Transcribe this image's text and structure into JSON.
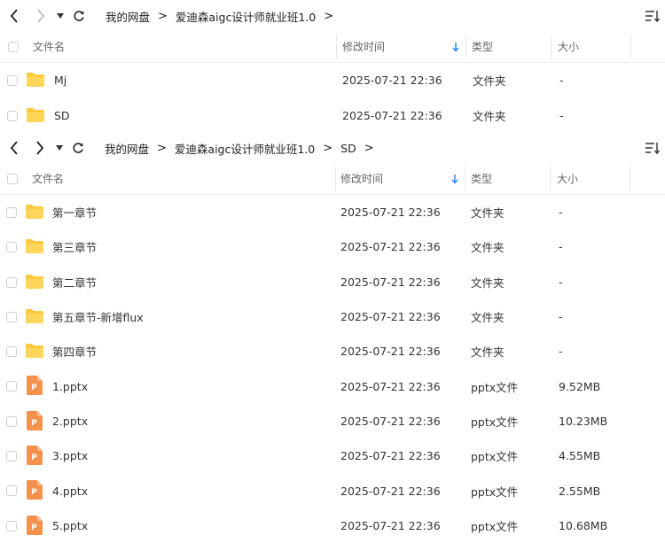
{
  "columns": {
    "name": "文件名",
    "modified": "修改时间",
    "type": "类型",
    "size": "大小"
  },
  "pane1": {
    "breadcrumb": [
      "我的网盘",
      "爱迪森aigc设计师就业班1.0"
    ],
    "rows": [
      {
        "name": "Mj",
        "modified": "2025-07-21 22:36",
        "type": "文件夹",
        "size": "-",
        "icon": "folder-icon"
      },
      {
        "name": "SD",
        "modified": "2025-07-21 22:36",
        "type": "文件夹",
        "size": "-",
        "icon": "folder-icon"
      }
    ]
  },
  "pane2": {
    "breadcrumb": [
      "我的网盘",
      "爱迪森aigc设计师就业班1.0",
      "SD"
    ],
    "rows": [
      {
        "name": "第一章节",
        "modified": "2025-07-21 22:36",
        "type": "文件夹",
        "size": "-",
        "icon": "folder-icon"
      },
      {
        "name": "第三章节",
        "modified": "2025-07-21 22:36",
        "type": "文件夹",
        "size": "-",
        "icon": "folder-icon"
      },
      {
        "name": "第二章节",
        "modified": "2025-07-21 22:36",
        "type": "文件夹",
        "size": "-",
        "icon": "folder-icon"
      },
      {
        "name": "第五章节-新增flux",
        "modified": "2025-07-21 22:36",
        "type": "文件夹",
        "size": "-",
        "icon": "folder-icon"
      },
      {
        "name": "第四章节",
        "modified": "2025-07-21 22:36",
        "type": "文件夹",
        "size": "-",
        "icon": "folder-icon"
      },
      {
        "name": "1.pptx",
        "modified": "2025-07-21 22:36",
        "type": "pptx文件",
        "size": "9.52MB",
        "icon": "pptx-file-icon"
      },
      {
        "name": "2.pptx",
        "modified": "2025-07-21 22:36",
        "type": "pptx文件",
        "size": "10.23MB",
        "icon": "pptx-file-icon"
      },
      {
        "name": "3.pptx",
        "modified": "2025-07-21 22:36",
        "type": "pptx文件",
        "size": "4.55MB",
        "icon": "pptx-file-icon"
      },
      {
        "name": "4.pptx",
        "modified": "2025-07-21 22:36",
        "type": "pptx文件",
        "size": "2.55MB",
        "icon": "pptx-file-icon"
      },
      {
        "name": "5.pptx",
        "modified": "2025-07-21 22:36",
        "type": "pptx文件",
        "size": "10.68MB",
        "icon": "pptx-file-icon"
      }
    ]
  },
  "colors": {
    "folder": "#ffc93c",
    "pptx": "#f4914c",
    "sort_arrow": "#2f8cff"
  }
}
